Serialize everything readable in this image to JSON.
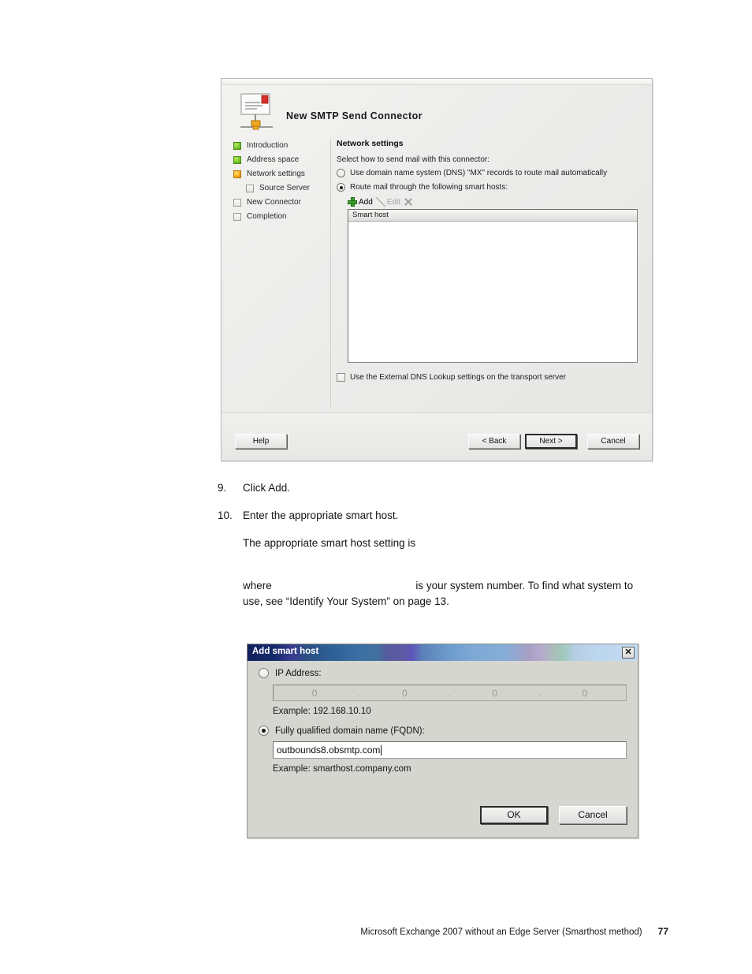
{
  "wizard": {
    "title": "New SMTP Send Connector",
    "icon": "smtp-send-connector-icon",
    "steps": [
      {
        "label": "Introduction",
        "state": "done",
        "sub": false
      },
      {
        "label": "Address space",
        "state": "done",
        "sub": false
      },
      {
        "label": "Network settings",
        "state": "current",
        "sub": false
      },
      {
        "label": "Source Server",
        "state": "todo",
        "sub": true
      },
      {
        "label": "New Connector",
        "state": "todo",
        "sub": false
      },
      {
        "label": "Completion",
        "state": "todo",
        "sub": false
      }
    ],
    "pane": {
      "title": "Network settings",
      "prompt": "Select how to send mail with this connector:",
      "radio_dns": "Use domain name system (DNS) \"MX\" records to route mail automatically",
      "radio_smarthost": "Route mail through the following smart hosts:",
      "toolbar": {
        "add": "Add",
        "edit": "Edit",
        "delete_icon": "delete-x-icon"
      },
      "list_header": "Smart host",
      "list_rows": [],
      "checkbox_label": "Use the External DNS Lookup settings on the transport server",
      "checkbox_checked": false
    },
    "buttons": {
      "help": "Help",
      "back": "< Back",
      "next": "Next >",
      "cancel": "Cancel"
    }
  },
  "steps_text": {
    "item9_num": "9.",
    "item9_text": "Click Add.",
    "item10_num": "10.",
    "item10_text": "Enter the appropriate smart host.",
    "item10_sub": "The appropriate smart host setting is",
    "where_word": "where",
    "where_rest": "is your system number. To find what system to",
    "where_line2": "use, see “Identify Your System” on page 13."
  },
  "dialog": {
    "title": "Add smart host",
    "close_icon": "close-icon",
    "ip_radio_label": "IP Address:",
    "ip_radio_selected": false,
    "ip_octets": [
      "0",
      "0",
      "0",
      "0"
    ],
    "ip_separator": ".",
    "ip_example": "Example: 192.168.10.10",
    "fqdn_radio_label": "Fully qualified domain name (FQDN):",
    "fqdn_radio_selected": true,
    "fqdn_value": "outbounds8.obsmtp.com",
    "fqdn_example": "Example: smarthost.company.com",
    "ok": "OK",
    "cancel": "Cancel"
  },
  "footer": {
    "text": "Microsoft Exchange 2007 without an Edge Server (Smarthost method)",
    "page": "77"
  }
}
